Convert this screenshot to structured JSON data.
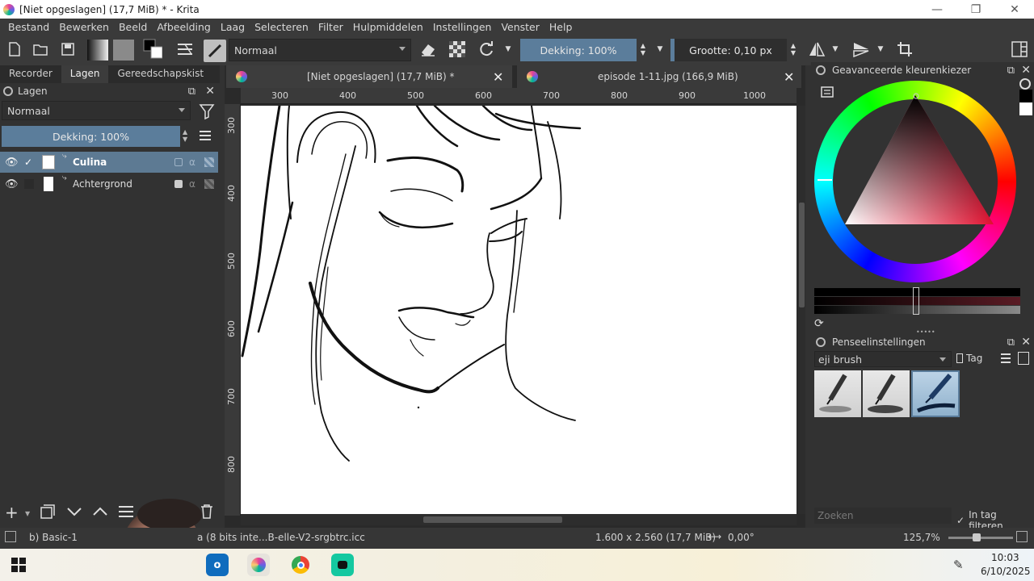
{
  "window": {
    "title": "[Niet opgeslagen]  (17,7 MiB) * - Krita",
    "minimize": "—",
    "maximize": "❐",
    "close": "✕"
  },
  "menu": [
    "Bestand",
    "Bewerken",
    "Beeld",
    "Afbeelding",
    "Laag",
    "Selecteren",
    "Filter",
    "Hulpmiddelen",
    "Instellingen",
    "Venster",
    "Help"
  ],
  "toolbar": {
    "blend_mode": "Normaal",
    "opacity": "Dekking: 100%",
    "size": "Grootte: 0,10 px"
  },
  "left_docker": {
    "tabs": [
      "Recorder",
      "Lagen",
      "Gereedschapskist"
    ],
    "panel_title": "Lagen",
    "blend_mode": "Normaal",
    "opacity": "Dekking:  100%",
    "layers": [
      {
        "name": "Culina",
        "selected": true
      },
      {
        "name": "Achtergrond",
        "selected": false
      }
    ]
  },
  "documents": {
    "tabs": [
      {
        "title": "[Niet opgeslagen]  (17,7 MiB) *"
      },
      {
        "title": "episode 1-11.jpg (166,9 MiB)"
      }
    ],
    "ruler_h": [
      "300",
      "400",
      "500",
      "600",
      "700",
      "800",
      "900",
      "1000"
    ],
    "ruler_v": [
      "300",
      "400",
      "500",
      "600",
      "700",
      "800"
    ]
  },
  "color_selector": {
    "title": "Geavanceerde kleurenkiezer",
    "hue_color": "#e0102f"
  },
  "brush_settings": {
    "title": "Penseelinstellingen",
    "preset_tag": "eji brush",
    "tag_label": "Tag",
    "search_placeholder": "Zoeken",
    "filter_label": "In tag filteren"
  },
  "statusbar": {
    "brush": "b) Basic-1",
    "color_profile": "a (8 bits inte...B-elle-V2-srgbtrc.icc",
    "dimensions": "1.600 x 2.560 (17,7 MiB)",
    "rotation": "0,00°",
    "zoom": "125,7%"
  },
  "taskbar": {
    "time": "10:03",
    "date": "6/10/2025"
  }
}
